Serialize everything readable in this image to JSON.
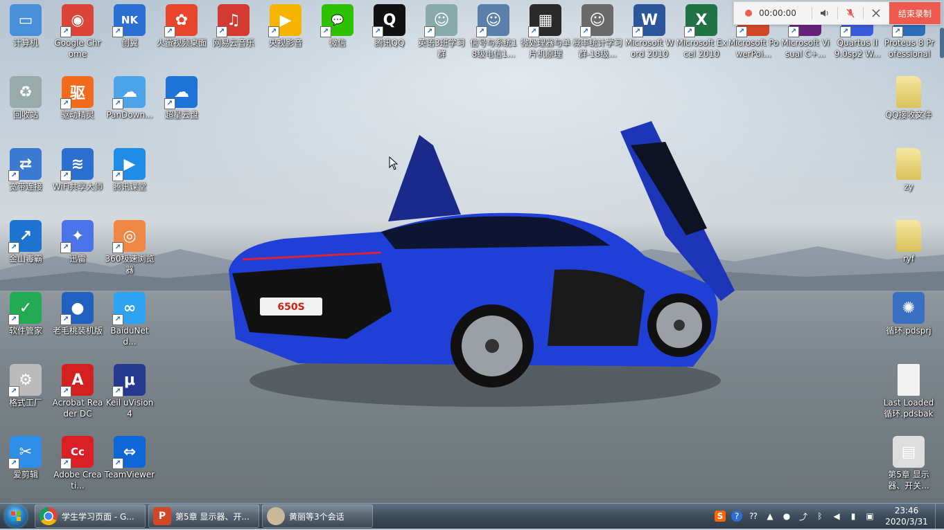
{
  "recorder": {
    "time": "00:00:00",
    "end_label": "结束录制"
  },
  "desktop": {
    "icons": [
      {
        "label": "计算机",
        "icon": "computer-icon",
        "color": "#4a90d9"
      },
      {
        "label": "Google Chrome",
        "icon": "chrome-icon",
        "color": "#db4437"
      },
      {
        "label": "创翼",
        "icon": "chuangyi-icon",
        "color": "#2a6fd1"
      },
      {
        "label": "火萤视频桌面",
        "icon": "firefly-icon",
        "color": "#e8452c"
      },
      {
        "label": "网易云音乐",
        "icon": "netease-music-icon",
        "color": "#d33a31"
      },
      {
        "label": "央视影音",
        "icon": "cctv-icon",
        "color": "#f6b400"
      },
      {
        "label": "微信",
        "icon": "wechat-icon",
        "color": "#2dc100"
      },
      {
        "label": "腾讯QQ",
        "icon": "qq-icon",
        "color": "#111111"
      },
      {
        "label": "英语3班学习群",
        "icon": "group-avatar-icon",
        "color": "#8aa"
      },
      {
        "label": "信号与系统18级电信1...",
        "icon": "group-avatar-icon",
        "color": "#5a7fa8"
      },
      {
        "label": "微处理器与单片机原理",
        "icon": "chip-icon",
        "color": "#2a2a2a"
      },
      {
        "label": "概率统计学习群-18级...",
        "icon": "group-avatar-icon",
        "color": "#6a6a6a"
      },
      {
        "label": "Microsoft Word 2010",
        "icon": "word-icon",
        "color": "#2b579a"
      },
      {
        "label": "Microsoft Excel 2010",
        "icon": "excel-icon",
        "color": "#217346"
      },
      {
        "label": "Microsoft PowerPoi...",
        "icon": "powerpoint-icon",
        "color": "#d24726"
      },
      {
        "label": "Microsoft Visual C+...",
        "icon": "visual-cpp-icon",
        "color": "#68217a"
      },
      {
        "label": "Quartus II 9.0sp2 W...",
        "icon": "quartus-icon",
        "color": "#3a5bd9"
      },
      {
        "label": "Proteus 8 Professional",
        "icon": "proteus-icon",
        "color": "#2d6db5"
      },
      {
        "label": "回收站",
        "icon": "recycle-bin-icon",
        "color": "#9aa"
      },
      {
        "label": "驱动精灵",
        "icon": "driver-genius-icon",
        "color": "#f26b1d"
      },
      {
        "label": "PanDown...",
        "icon": "cloud-icon",
        "color": "#4da3e8"
      },
      {
        "label": "超星云盘",
        "icon": "cloud-disk-icon",
        "color": "#1d73d6"
      },
      {
        "label": "宽带连接",
        "icon": "network-icon",
        "color": "#3b7ad1"
      },
      {
        "label": "WiFi共享大师",
        "icon": "wifi-icon",
        "color": "#2b6fd1"
      },
      {
        "label": "腾讯课堂",
        "icon": "tencent-class-icon",
        "color": "#1f8ce6"
      },
      {
        "label": "金山毒霸",
        "icon": "kingsoft-icon",
        "color": "#1e73d1"
      },
      {
        "label": "迅雷",
        "icon": "thunder-icon",
        "color": "#4b73e8"
      },
      {
        "label": "360极速浏览器",
        "icon": "360-browser-icon",
        "color": "#e84"
      },
      {
        "label": "软件管家",
        "icon": "software-manager-icon",
        "color": "#2a5"
      },
      {
        "label": "老毛桃装机版",
        "icon": "peach-icon",
        "color": "#2060c0"
      },
      {
        "label": "BaiduNetd...",
        "icon": "baidu-netdisk-icon",
        "color": "#2ea3f2"
      },
      {
        "label": "格式工厂",
        "icon": "format-factory-icon",
        "color": "#bbb"
      },
      {
        "label": "Acrobat Reader DC",
        "icon": "acrobat-icon",
        "color": "#d4201f"
      },
      {
        "label": "Keil uVision4",
        "icon": "keil-icon",
        "color": "#253a8f"
      },
      {
        "label": "爱剪辑",
        "icon": "aijianji-icon",
        "color": "#2f8ee8"
      },
      {
        "label": "Adobe Creati...",
        "icon": "adobe-cc-icon",
        "color": "#da1f26"
      },
      {
        "label": "TeamViewer",
        "icon": "teamviewer-icon",
        "color": "#0e67d6"
      },
      {
        "label": "QQ接收文件",
        "icon": "folder-icon",
        "color": "#e8d36a"
      },
      {
        "label": "zy",
        "icon": "folder-icon",
        "color": "#e8d36a"
      },
      {
        "label": "ryf",
        "icon": "folder-icon",
        "color": "#e8d36a"
      },
      {
        "label": "循环.pdsprj",
        "icon": "proteus-project-icon",
        "color": "#3b6fc2"
      },
      {
        "label": "Last Loaded 循环.pdsbak",
        "icon": "file-icon",
        "color": "#f2f2f2"
      },
      {
        "label": "第5章 显示器、开关...",
        "icon": "pptx-file-icon",
        "color": "#ddd"
      }
    ]
  },
  "taskbar": {
    "tasks": [
      {
        "label": "学生学习页面 - G...",
        "icon": "chrome-icon"
      },
      {
        "label": "第5章 显示器、开...",
        "icon": "powerpoint-icon"
      },
      {
        "label": "黄丽等3个会话",
        "icon": "chat-avatar-icon"
      }
    ],
    "clock_time": "23:46",
    "clock_date": "2020/3/31"
  }
}
